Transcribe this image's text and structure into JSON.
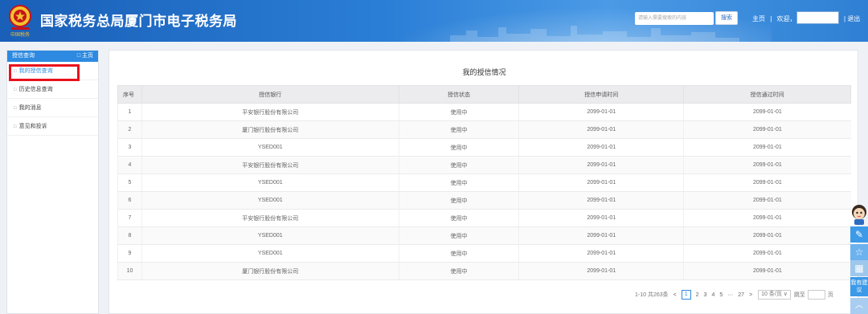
{
  "header": {
    "title": "国家税务总局厦门市电子税务局",
    "emblem_caption": "中国税务",
    "search_placeholder": "请输入需要搜索的内容",
    "search_button": "搜索",
    "home_link": "主页",
    "separator": "|",
    "welcome": "欢迎，",
    "logout": "退出"
  },
  "sidebar": {
    "head": "授信查询",
    "home": "□ 主页",
    "bullet": "□",
    "items": [
      {
        "label": "我的授信查询"
      },
      {
        "label": "历史信息查询"
      },
      {
        "label": "我的消息"
      },
      {
        "label": "意见和投诉"
      }
    ]
  },
  "main": {
    "title": "我的授信情况",
    "columns": [
      "序号",
      "授信银行",
      "授信状态",
      "授信申请时间",
      "授信通过时间"
    ],
    "rows": [
      [
        "1",
        "平安银行股份有限公司",
        "使用中",
        "2099-01-01",
        "2099-01-01"
      ],
      [
        "2",
        "厦门银行股份有限公司",
        "使用中",
        "2099-01-01",
        "2099-01-01"
      ],
      [
        "3",
        "YSED001",
        "使用中",
        "2099-01-01",
        "2099-01-01"
      ],
      [
        "4",
        "平安银行股份有限公司",
        "使用中",
        "2099-01-01",
        "2099-01-01"
      ],
      [
        "5",
        "YSED001",
        "使用中",
        "2099-01-01",
        "2099-01-01"
      ],
      [
        "6",
        "YSED001",
        "使用中",
        "2099-01-01",
        "2099-01-01"
      ],
      [
        "7",
        "平安银行股份有限公司",
        "使用中",
        "2099-01-01",
        "2099-01-01"
      ],
      [
        "8",
        "YSED001",
        "使用中",
        "2099-01-01",
        "2099-01-01"
      ],
      [
        "9",
        "YSED001",
        "使用中",
        "2099-01-01",
        "2099-01-01"
      ],
      [
        "10",
        "厦门银行股份有限公司",
        "使用中",
        "2099-01-01",
        "2099-01-01"
      ]
    ]
  },
  "pagination": {
    "summary": "1-10 共263条",
    "prev": "<",
    "pages": [
      "1",
      "2",
      "3",
      "4",
      "5",
      "···",
      "27"
    ],
    "next": ">",
    "page_size": "10 条/页 ∨",
    "goto_label": "跳至",
    "page_suffix": "页"
  },
  "float_tools": {
    "tool1_icon": "edit-icon",
    "tool2_icon": "star-icon",
    "tool3_icon": "calculator-icon",
    "suggest_label": "我有建议",
    "top_icon": "chevron-up-icon"
  },
  "colors": {
    "header_blue": "#1a5fb8",
    "accent": "#2d8ae0",
    "highlight_red": "#e8121b"
  }
}
